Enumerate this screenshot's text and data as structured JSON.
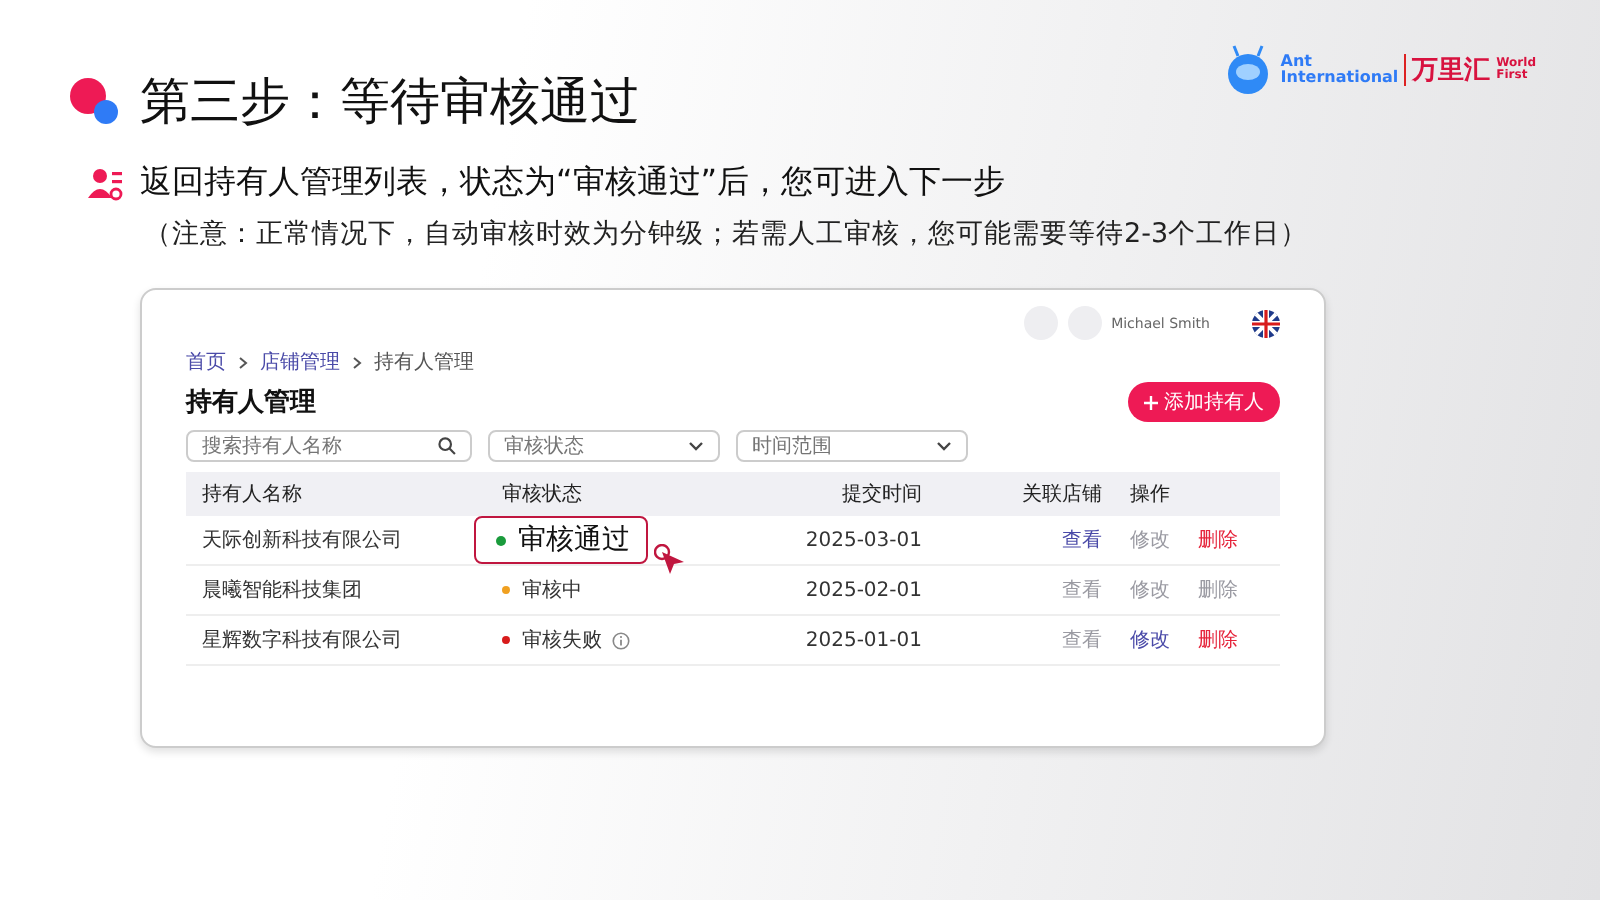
{
  "slide": {
    "title": "第三步：等待审核通过",
    "instruction": "返回持有人管理列表，状态为“审核通过”后，您可进入下一步",
    "note": "（注意：正常情况下，自动审核时效为分钟级；若需人工审核，您可能需要等待2-3个工作日）"
  },
  "logo": {
    "brand": "Ant",
    "brand_line2": "International",
    "cn_name": "万里汇",
    "en_name_line1": "World",
    "en_name_line2": "First"
  },
  "app": {
    "user_name": "Michael Smith",
    "breadcrumb": [
      {
        "label": "首页",
        "link": true
      },
      {
        "label": "店铺管理",
        "link": true
      },
      {
        "label": "持有人管理",
        "link": false
      }
    ],
    "page_title": "持有人管理",
    "add_button": "添加持有人",
    "filters": [
      {
        "kind": "search",
        "placeholder": "搜索持有人名称"
      },
      {
        "kind": "select",
        "placeholder": "审核状态"
      },
      {
        "kind": "select",
        "placeholder": "时间范围"
      }
    ],
    "table": {
      "columns": [
        "持有人名称",
        "审核状态",
        "提交时间",
        "关联店铺",
        "操作"
      ],
      "rows": [
        {
          "name": "天际创新科技有限公司",
          "status": "审核通过",
          "color": "#1a9b3c",
          "highlighted": true,
          "info": false,
          "date": "2025-03-01",
          "actions": [
            {
              "label": "查看",
              "kind": "view",
              "disabled": false
            },
            {
              "label": "修改",
              "kind": "edit",
              "disabled": true
            },
            {
              "label": "删除",
              "kind": "delete",
              "disabled": false
            }
          ]
        },
        {
          "name": "晨曦智能科技集团",
          "status": "审核中",
          "color": "#f0a020",
          "highlighted": false,
          "info": false,
          "date": "2025-02-01",
          "actions": [
            {
              "label": "查看",
              "kind": "view",
              "disabled": true
            },
            {
              "label": "修改",
              "kind": "edit",
              "disabled": true
            },
            {
              "label": "删除",
              "kind": "delete",
              "disabled": true
            }
          ]
        },
        {
          "name": "星辉数字科技有限公司",
          "status": "审核失败",
          "color": "#d81b1b",
          "highlighted": false,
          "info": true,
          "date": "2025-01-01",
          "actions": [
            {
              "label": "查看",
              "kind": "view",
              "disabled": true
            },
            {
              "label": "修改",
              "kind": "edit",
              "disabled": false
            },
            {
              "label": "删除",
              "kind": "delete",
              "disabled": false
            }
          ]
        }
      ]
    }
  }
}
